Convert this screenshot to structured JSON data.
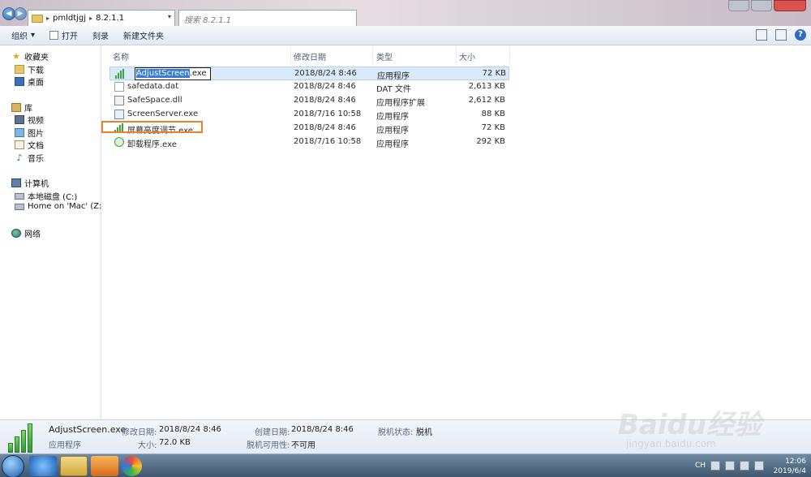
{
  "address_bar": {
    "crumbs": [
      "pmldtjgj",
      "8.2.1.1"
    ],
    "search_placeholder": "搜索 8.2.1.1"
  },
  "toolbar": {
    "organize": "组织",
    "open": "打开",
    "burn": "刻录",
    "new_folder": "新建文件夹"
  },
  "sidebar": {
    "favorites": "收藏夹",
    "downloads": "下载",
    "desktop": "桌面",
    "libraries": "库",
    "videos": "视频",
    "pictures": "图片",
    "documents": "文档",
    "music": "音乐",
    "computer": "计算机",
    "local_disk": "本地磁盘 (C:)",
    "mac_home": "Home on 'Mac' (Z:)",
    "network": "网络"
  },
  "columns": {
    "name": "名称",
    "modified": "修改日期",
    "type": "类型",
    "size": "大小"
  },
  "files": [
    {
      "name": "AdjustScreen.exe",
      "rename_selected": "AdjustScreen",
      "rename_ext": ".exe",
      "date": "2018/8/24 8:46",
      "type": "应用程序",
      "size": "72 KB",
      "icon": "exe-bars-icon"
    },
    {
      "name": "safedata.dat",
      "date": "2018/8/24 8:46",
      "type": "DAT 文件",
      "size": "2,613 KB",
      "icon": "blank-file-icon"
    },
    {
      "name": "SafeSpace.dll",
      "date": "2018/8/24 8:46",
      "type": "应用程序扩展",
      "size": "2,612 KB",
      "icon": "dll-icon"
    },
    {
      "name": "ScreenServer.exe",
      "date": "2018/7/16 10:58",
      "type": "应用程序",
      "size": "88 KB",
      "icon": "app-icon"
    },
    {
      "name": "屏幕亮度调节.exe",
      "date": "2018/8/24 8:46",
      "type": "应用程序",
      "size": "72 KB",
      "icon": "exe-bars-icon"
    },
    {
      "name": "卸载程序.exe",
      "date": "2018/7/16 10:58",
      "type": "应用程序",
      "size": "292 KB",
      "icon": "uninstall-icon"
    }
  ],
  "details": {
    "filename": "AdjustScreen.exe",
    "filetype": "应用程序",
    "modified_label": "修改日期:",
    "modified_value": "2018/8/24 8:46",
    "size_label": "大小:",
    "size_value": "72.0 KB",
    "created_label": "创建日期:",
    "created_value": "2018/8/24 8:46",
    "offline_avail_label": "脱机可用性:",
    "offline_avail_value": "不可用",
    "offline_status_label": "脱机状态:",
    "offline_status_value": "脱机"
  },
  "taskbar": {
    "time": "12:06",
    "date": "2019/6/4",
    "lang": "CH"
  },
  "watermark": {
    "logo": "Baidu经验",
    "url": "jingyan.baidu.com"
  },
  "colors": {
    "highlight": "#3a7bd5",
    "orange_box": "#e8822a",
    "selected_row": "#dbeafb"
  }
}
